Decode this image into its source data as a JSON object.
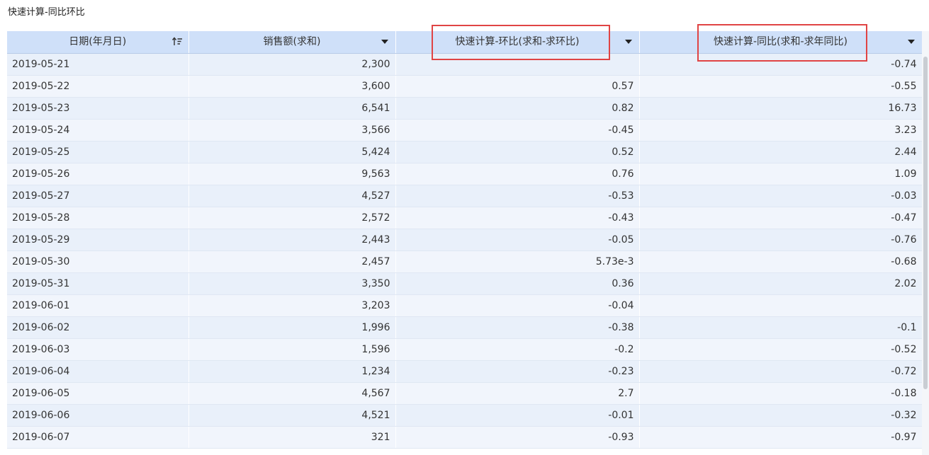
{
  "title": "快速计算-同比环比",
  "colors": {
    "header_bg": "#cfe0f9",
    "row_odd": "#e9f0fa",
    "row_even": "#f1f5fc",
    "highlight": "#e04444"
  },
  "headers": {
    "date": "日期(年月日)",
    "sales": "销售额(求和)",
    "mom": "快速计算-环比(求和-求环比)",
    "yoy": "快速计算-同比(求和-求年同比)"
  },
  "icons": {
    "sort": "sort-ascending-icon",
    "dropdown": "caret-down-icon"
  },
  "rows": [
    {
      "date": "2019-05-21",
      "sales": "2,300",
      "mom": "",
      "yoy": "-0.74"
    },
    {
      "date": "2019-05-22",
      "sales": "3,600",
      "mom": "0.57",
      "yoy": "-0.55"
    },
    {
      "date": "2019-05-23",
      "sales": "6,541",
      "mom": "0.82",
      "yoy": "16.73"
    },
    {
      "date": "2019-05-24",
      "sales": "3,566",
      "mom": "-0.45",
      "yoy": "3.23"
    },
    {
      "date": "2019-05-25",
      "sales": "5,424",
      "mom": "0.52",
      "yoy": "2.44"
    },
    {
      "date": "2019-05-26",
      "sales": "9,563",
      "mom": "0.76",
      "yoy": "1.09"
    },
    {
      "date": "2019-05-27",
      "sales": "4,527",
      "mom": "-0.53",
      "yoy": "-0.03"
    },
    {
      "date": "2019-05-28",
      "sales": "2,572",
      "mom": "-0.43",
      "yoy": "-0.47"
    },
    {
      "date": "2019-05-29",
      "sales": "2,443",
      "mom": "-0.05",
      "yoy": "-0.76"
    },
    {
      "date": "2019-05-30",
      "sales": "2,457",
      "mom": "5.73e-3",
      "yoy": "-0.68"
    },
    {
      "date": "2019-05-31",
      "sales": "3,350",
      "mom": "0.36",
      "yoy": "2.02"
    },
    {
      "date": "2019-06-01",
      "sales": "3,203",
      "mom": "-0.04",
      "yoy": ""
    },
    {
      "date": "2019-06-02",
      "sales": "1,996",
      "mom": "-0.38",
      "yoy": "-0.1"
    },
    {
      "date": "2019-06-03",
      "sales": "1,596",
      "mom": "-0.2",
      "yoy": "-0.52"
    },
    {
      "date": "2019-06-04",
      "sales": "1,234",
      "mom": "-0.23",
      "yoy": "-0.72"
    },
    {
      "date": "2019-06-05",
      "sales": "4,567",
      "mom": "2.7",
      "yoy": "-0.18"
    },
    {
      "date": "2019-06-06",
      "sales": "4,521",
      "mom": "-0.01",
      "yoy": "-0.32"
    },
    {
      "date": "2019-06-07",
      "sales": "321",
      "mom": "-0.93",
      "yoy": "-0.97"
    }
  ]
}
